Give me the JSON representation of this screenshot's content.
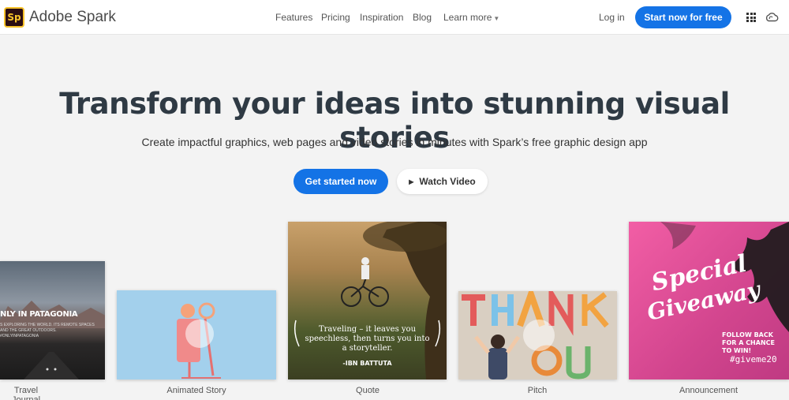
{
  "header": {
    "logo_text": "Sp",
    "brand": "Adobe Spark",
    "nav": [
      "Features",
      "Pricing",
      "Inspiration",
      "Blog"
    ],
    "learn_more": "Learn more",
    "login": "Log in",
    "cta": "Start now for free",
    "icons": [
      "apps-grid-icon",
      "creative-cloud-icon"
    ]
  },
  "hero": {
    "title": "Transform your ideas into stunning visual stories",
    "subtitle": "Create impactful graphics, web pages and video stories in minutes with Spark’s free graphic design app",
    "primary_button": "Get started now",
    "secondary_button": "Watch Video"
  },
  "cards": {
    "travel": {
      "label": "Travel Journal",
      "title": "NLY IN PATAGONIA",
      "body": "S EXPLORING THE WORLD. ITS REMOTE SPACES AND THE GREAT OUTDOORS. #ONLYINPATAGONIA"
    },
    "animated": {
      "label": "Animated Story"
    },
    "quote": {
      "label": "Quote",
      "text": "Traveling – it leaves you speechless, then turns you into a storyteller.",
      "author": "-IBN BATTUTA"
    },
    "pitch": {
      "label": "Pitch"
    },
    "announcement": {
      "label": "Announcement",
      "line1": "Special",
      "line2": "Giveaway",
      "follow": "FOLLOW BACK FOR A CHANCE TO WIN!",
      "hashtag": "#giveme20"
    }
  },
  "colors": {
    "accent": "#1473e6",
    "logo_bg": "#2b0d12",
    "logo_fg": "#f8c32b",
    "background": "#f3f3f3"
  }
}
